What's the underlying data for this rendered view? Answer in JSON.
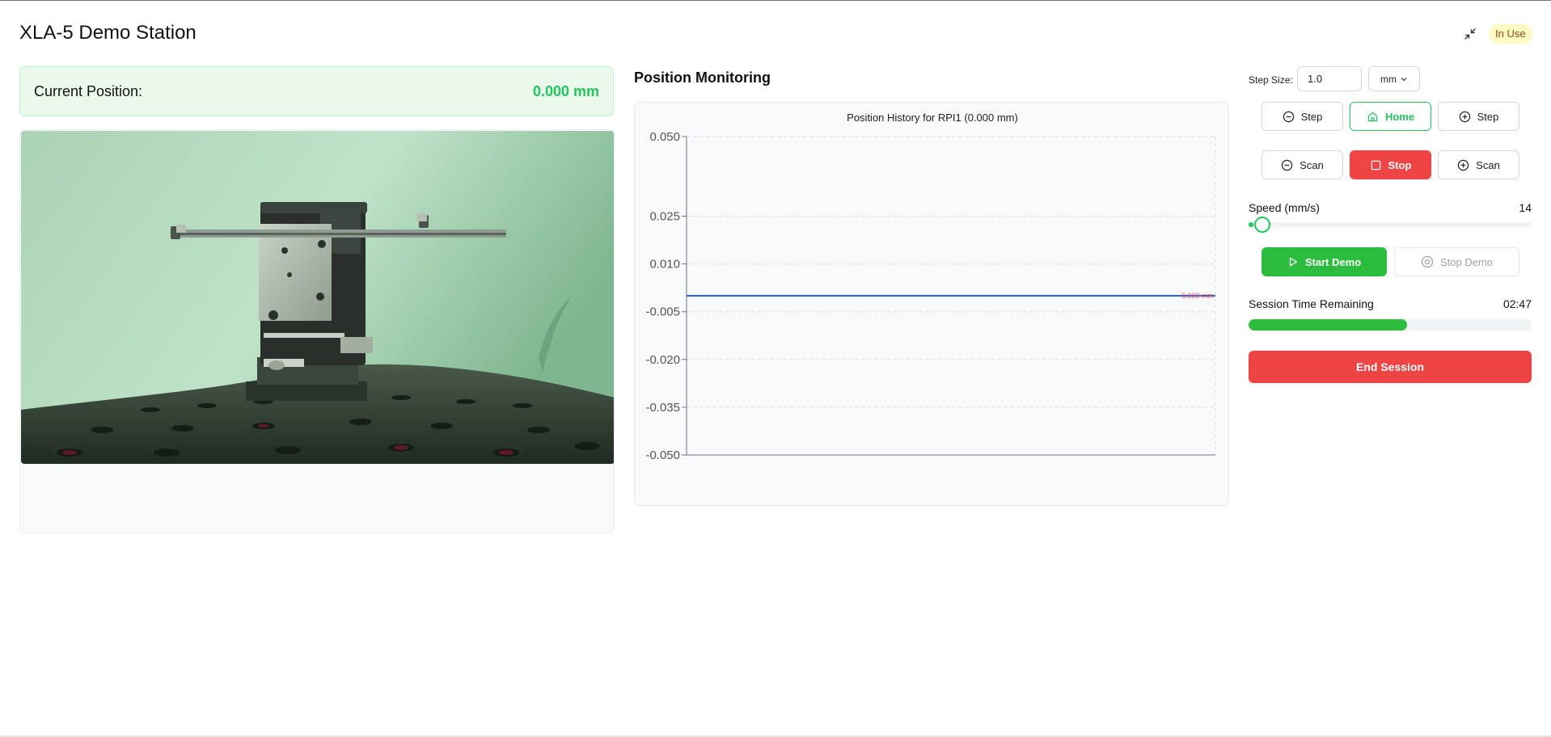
{
  "header": {
    "title": "XLA-5 Demo Station",
    "collapse_icon": "collapse-arrows-icon",
    "status_badge": "In Use"
  },
  "position": {
    "label": "Current Position:",
    "value": "0.000 mm"
  },
  "monitoring": {
    "section_title": "Position Monitoring"
  },
  "chart_data": {
    "type": "line",
    "title": "Position History for RPI1 (0.000 mm)",
    "xlabel": "",
    "ylabel": "",
    "y_ticks": [
      "0.050",
      "0.025",
      "0.010",
      "-0.005",
      "-0.020",
      "-0.035",
      "-0.050"
    ],
    "y_tick_values": [
      0.05,
      0.025,
      0.01,
      -0.005,
      -0.02,
      -0.035,
      -0.05
    ],
    "ylim": [
      -0.05,
      0.05
    ],
    "grid": true,
    "series": [
      {
        "color": "#2563eb",
        "values": [
          0,
          0,
          0,
          0,
          0,
          0,
          0,
          0,
          0,
          0,
          0,
          0,
          0,
          0,
          0,
          0,
          0,
          0,
          0,
          0
        ]
      }
    ],
    "end_label": "0.000 mm",
    "end_label_color": "#ef4444"
  },
  "controls": {
    "step_size_label": "Step Size:",
    "step_size_value": "1.0",
    "unit": "mm",
    "step_minus": "Step",
    "home": "Home",
    "step_plus": "Step",
    "scan_minus": "Scan",
    "stop": "Stop",
    "scan_plus": "Scan",
    "speed_label": "Speed (mm/s)",
    "speed_value": "14",
    "speed_fraction": 0.01,
    "start_demo": "Start Demo",
    "stop_demo": "Stop Demo",
    "session_label": "Session Time Remaining",
    "session_value": "02:47",
    "session_fraction": 0.56,
    "end_session": "End Session"
  },
  "colors": {
    "accent_green": "#22c55e",
    "danger_red": "#ef4444",
    "line_blue": "#2563eb"
  }
}
